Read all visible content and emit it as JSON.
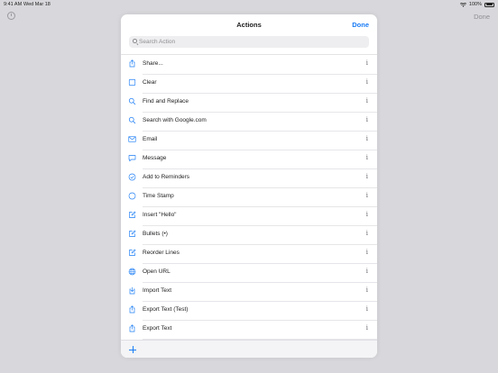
{
  "status_bar": {
    "time": "9:41 AM",
    "date": "Wed Mar 18",
    "battery": "100%"
  },
  "background_app": {
    "done_label": "Done"
  },
  "sheet": {
    "title": "Actions",
    "done_label": "Done",
    "search_placeholder": "Search Action"
  },
  "accent_color": "#1a7cf5",
  "actions": [
    {
      "label": "Share...",
      "icon": "share-icon"
    },
    {
      "label": "Clear",
      "icon": "square-icon"
    },
    {
      "label": "Find and Replace",
      "icon": "magnifier-icon"
    },
    {
      "label": "Search with Google.com",
      "icon": "magnifier-icon"
    },
    {
      "label": "Email",
      "icon": "envelope-icon"
    },
    {
      "label": "Message",
      "icon": "speech-bubble-icon"
    },
    {
      "label": "Add to Reminders",
      "icon": "checkmark-circle-icon"
    },
    {
      "label": "Time Stamp",
      "icon": "circle-icon"
    },
    {
      "label": "Insert \"Hello\"",
      "icon": "compose-icon"
    },
    {
      "label": "Bullets (•)",
      "icon": "compose-icon"
    },
    {
      "label": "Reorder Lines",
      "icon": "compose-icon"
    },
    {
      "label": "Open URL",
      "icon": "globe-icon"
    },
    {
      "label": "Import Text",
      "icon": "import-icon"
    },
    {
      "label": "Export Text (Test)",
      "icon": "share-icon"
    },
    {
      "label": "Export Text",
      "icon": "share-icon"
    }
  ],
  "info_glyph": "i"
}
